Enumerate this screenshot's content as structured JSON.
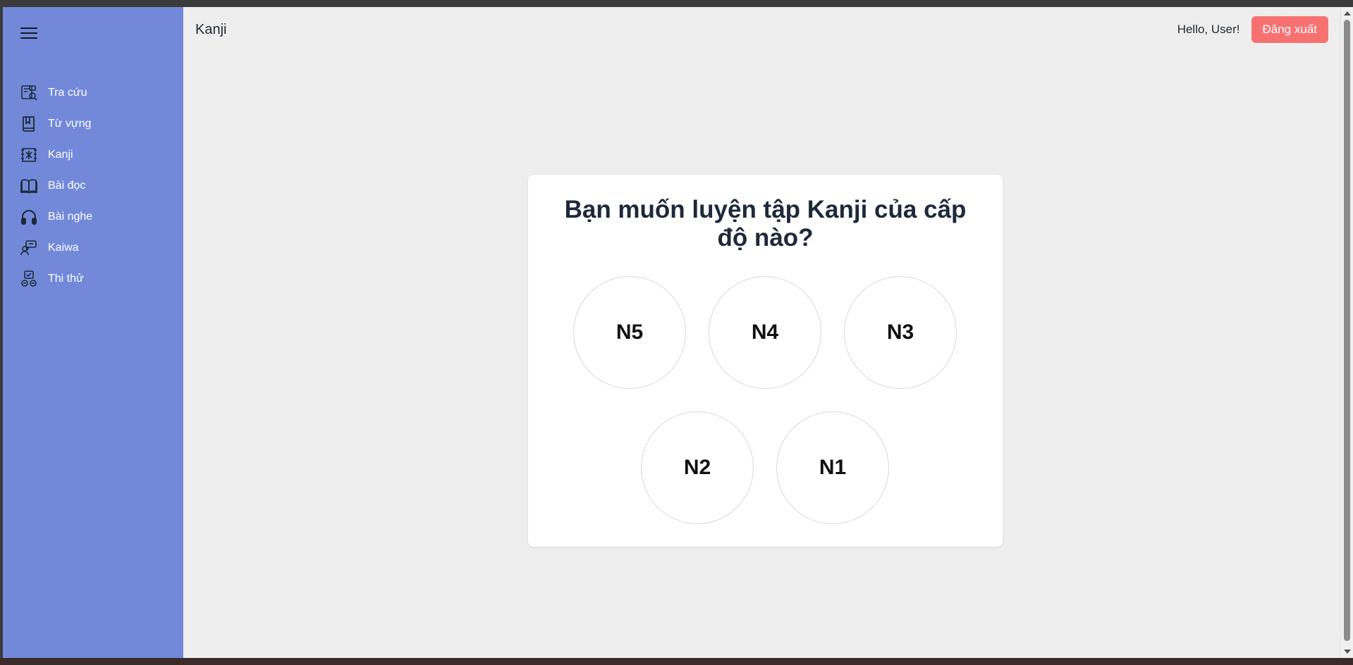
{
  "header": {
    "title": "Kanji",
    "greeting": "Hello, User!",
    "logout_label": "Đăng xuất"
  },
  "sidebar": {
    "menu_icon": "hamburger-menu-icon",
    "items": [
      {
        "label": "Tra cứu",
        "icon": "dictionary-search-icon"
      },
      {
        "label": "Từ vựng",
        "icon": "book-icon"
      },
      {
        "label": "Kanji",
        "icon": "kanji-icon"
      },
      {
        "label": "Bài đọc",
        "icon": "open-book-icon"
      },
      {
        "label": "Bài nghe",
        "icon": "headphones-icon"
      },
      {
        "label": "Kaiwa",
        "icon": "conversation-icon"
      },
      {
        "label": "Thi thử",
        "icon": "exam-icon"
      }
    ]
  },
  "main": {
    "question": "Bạn muốn luyện tập Kanji của cấp độ nào?",
    "levels": [
      "N5",
      "N4",
      "N3",
      "N2",
      "N1"
    ]
  },
  "colors": {
    "sidebar_bg": "#7289da",
    "page_bg": "#eeeeee",
    "logout_bg": "#f87171",
    "card_bg": "#ffffff"
  }
}
